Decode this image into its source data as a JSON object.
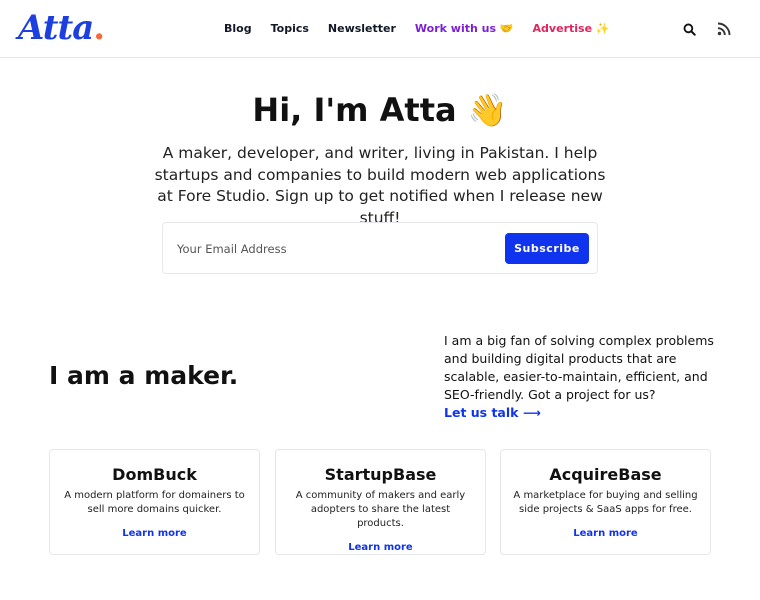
{
  "header": {
    "logo_text": "Atta",
    "logo_dot": ".",
    "nav": [
      {
        "label": "Blog"
      },
      {
        "label": "Topics"
      },
      {
        "label": "Newsletter"
      },
      {
        "label": "Work with us 🤝"
      },
      {
        "label": "Advertise ✨"
      }
    ],
    "icons": [
      "search-icon",
      "rss-icon"
    ],
    "colors": {
      "brand": "#1d3fe0",
      "logo_dot": "#f26b3a",
      "work": "#7c1fd1",
      "advertise": "#e0245e"
    }
  },
  "hero": {
    "title": "Hi, I'm Atta 👋",
    "text": "A maker, developer, and writer, living in Pakistan. I help startups and companies to build modern web applications at Fore Studio. Sign up to get notified when I release new stuff!",
    "email_placeholder": "Your Email Address",
    "subscribe_label": "Subscribe",
    "accent": "#1034ee"
  },
  "maker": {
    "title": "I am a maker.",
    "text": "I am a big fan of solving complex problems and building digital products that are scalable, easier-to-maintain, efficient, and SEO-friendly. Got a project for us?",
    "cta": "Let us talk ⟶"
  },
  "cards": [
    {
      "title": "DomBuck",
      "text": "A modern platform for domainers to sell more domains quicker.",
      "link": "Learn more"
    },
    {
      "title": "StartupBase",
      "text": "A community of makers and early adopters to share the latest products.",
      "link": "Learn more"
    },
    {
      "title": "AcquireBase",
      "text": "A marketplace for buying and selling side projects & SaaS apps for free.",
      "link": "Learn more"
    }
  ]
}
